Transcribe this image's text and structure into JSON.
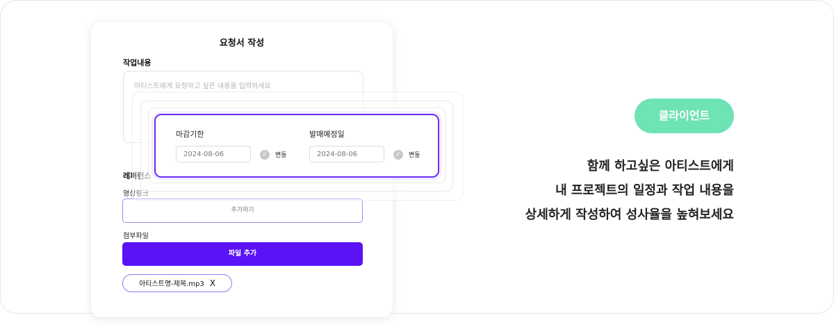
{
  "form": {
    "title": "요청서 작성",
    "work_content_label": "작업내용",
    "work_content_placeholder": "아티스트에게 요청하고 싶은 내용을 입력하세요",
    "reference_label": "레퍼런스",
    "video_link_label": "영상링크",
    "add_link_placeholder": "추가하기",
    "attachment_label": "첨부파일",
    "add_file_button": "파일 추가",
    "attached_file": "아티스트명-제목.mp3",
    "remove_symbol": "X"
  },
  "dates": {
    "deadline_label": "마감기한",
    "deadline_value": "2024-08-06",
    "release_label": "발매예정일",
    "release_value": "2024-08-06",
    "change_label": "변동",
    "check_symbol": "✓"
  },
  "side": {
    "badge": "클라이언트",
    "lines": [
      "함께 하고싶은 아티스트에게",
      "내 프로젝트의 일정과 작업 내용을",
      "상세하게 작성하여 성사율을 높혀보세요"
    ]
  },
  "colors": {
    "accent": "#5b12f7",
    "badge": "#6ee3b4"
  }
}
